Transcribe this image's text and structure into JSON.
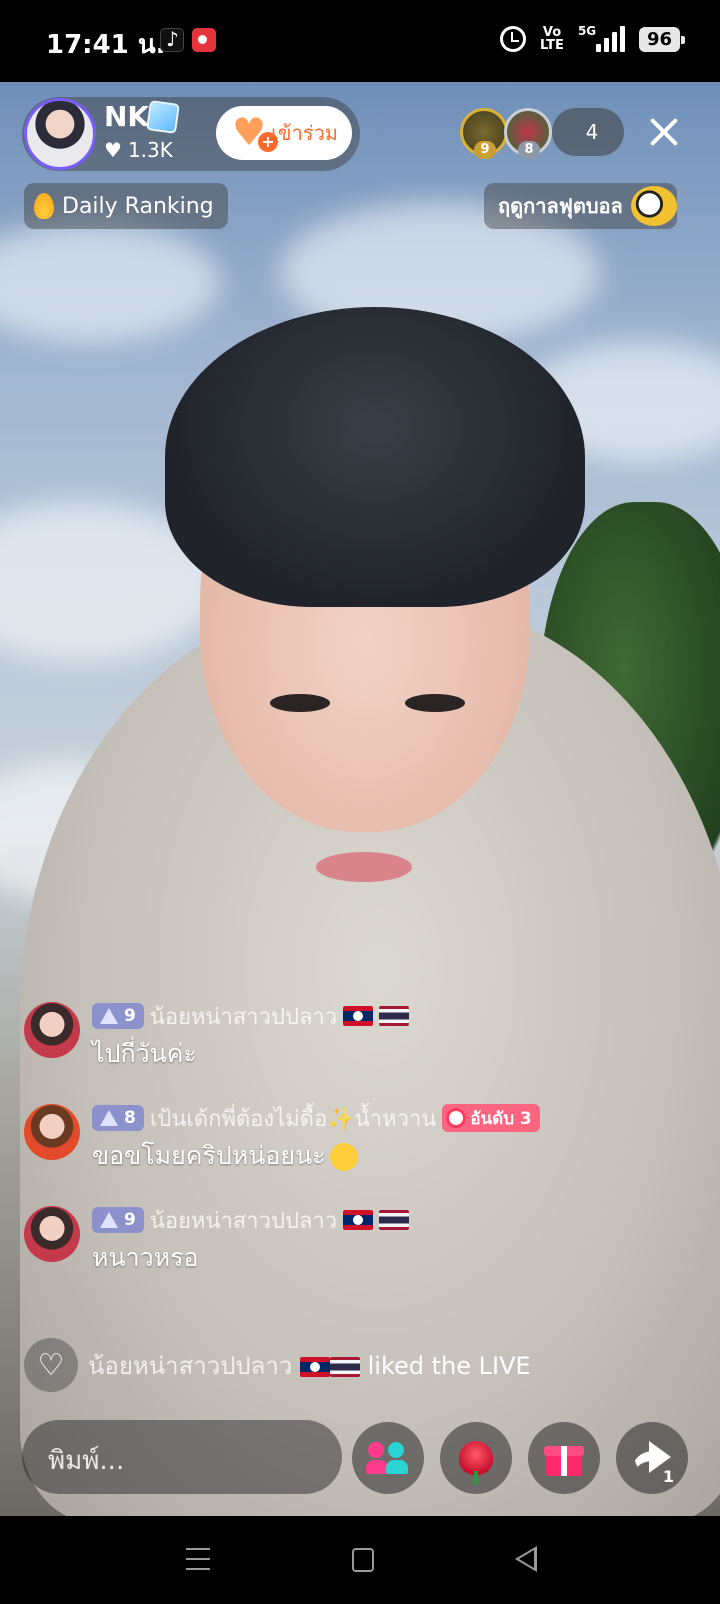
{
  "status_bar": {
    "time": "17:41 น.",
    "volte_line1": "Vo",
    "volte_line2": "LTE",
    "network": "5G",
    "battery": "96"
  },
  "host": {
    "name": "NK",
    "likes": "1.3K",
    "join_label": "เข้าร่วม"
  },
  "viewers": {
    "top": [
      {
        "badge": "9",
        "border_color": "#d8b13a"
      },
      {
        "badge": "8",
        "border_color": "#c9ced6"
      }
    ],
    "count": "4"
  },
  "banners": {
    "ranking": "Daily Ranking",
    "football": "ฤดูกาลฟุตบอล"
  },
  "chat": [
    {
      "level": "9",
      "user": "น้อยหน่าสาวปปลาว",
      "flags": [
        "laos",
        "thailand"
      ],
      "message": "ไปกี่วันค่ะ"
    },
    {
      "level": "8",
      "user": "เป้นเด้กพี่ต้องไม่ดื้อ✨น้ำหวาน",
      "rank_badge": "อันดับ 3",
      "message": "ขอขโมยคริปหน่อยนะ",
      "message_emoji": "shushing-face"
    },
    {
      "level": "9",
      "user": "น้อยหน่าสาวปปลาว",
      "flags": [
        "laos",
        "thailand"
      ],
      "message": "หนาวหรอ"
    }
  ],
  "like_event": {
    "user": "น้อยหน่าสาวปปลาว",
    "text": "liked the LIVE"
  },
  "comment_input": {
    "placeholder": "พิมพ์..."
  },
  "controls": [
    "guests-icon",
    "rose-gift-icon",
    "gift-icon",
    "share-icon"
  ],
  "share_count": "1",
  "colors": {
    "join_text": "#ff6a2a",
    "level_badge": "#7882d2",
    "rank_badge": "#ff5a78",
    "gift": "#ff2a6a"
  }
}
